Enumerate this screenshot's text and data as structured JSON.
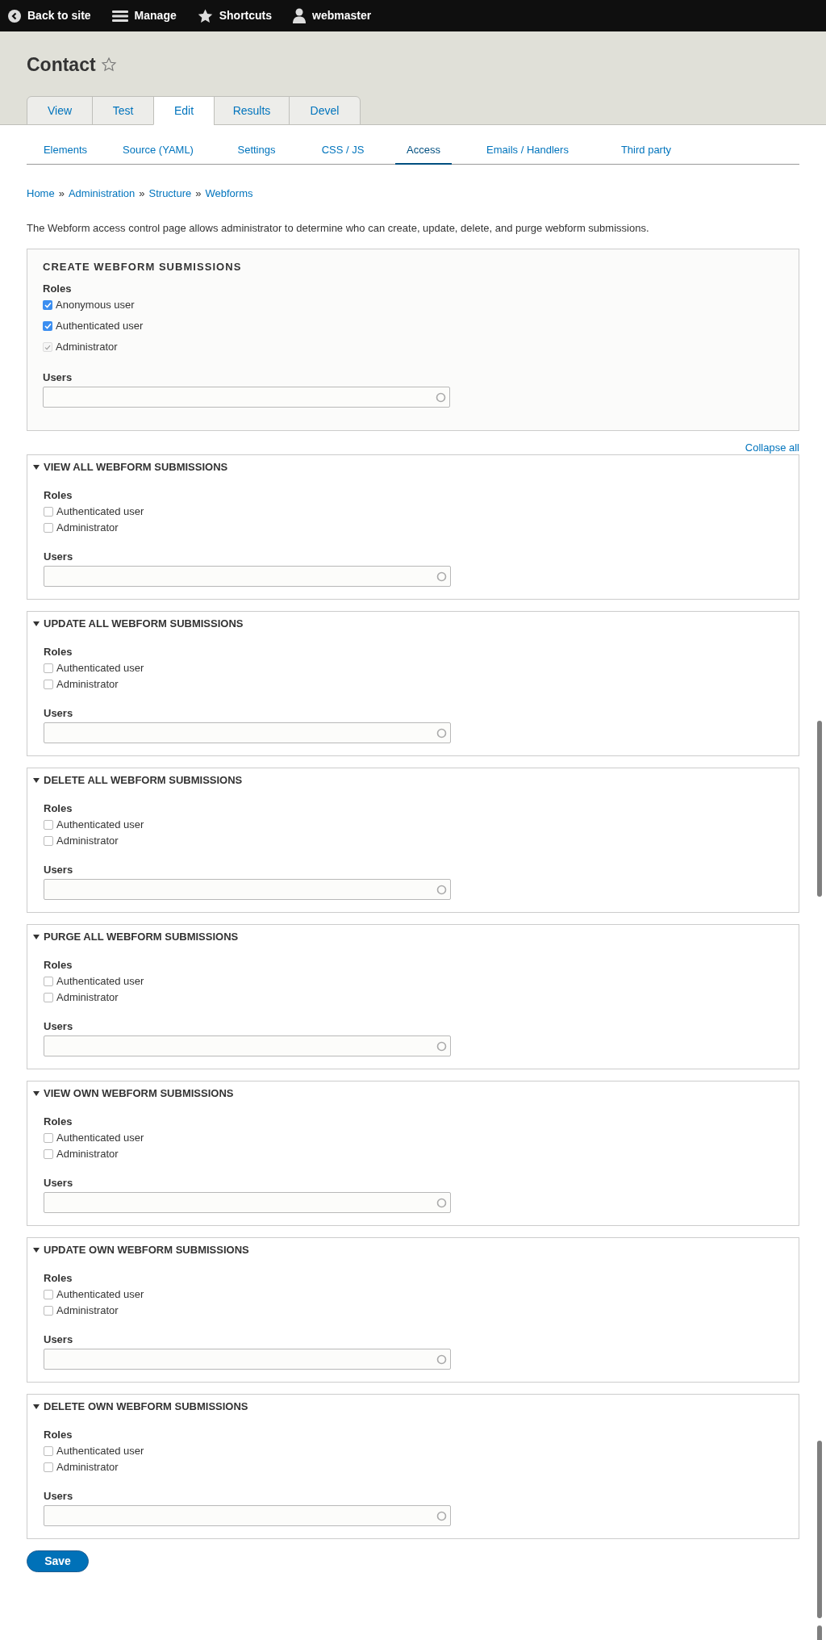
{
  "toolbar": [
    {
      "label": "Back to site"
    },
    {
      "label": "Manage"
    },
    {
      "label": "Shortcuts"
    },
    {
      "label": "webmaster"
    }
  ],
  "page_title": "Contact",
  "primary_tabs": [
    {
      "label": "View",
      "selected": false
    },
    {
      "label": "Test",
      "selected": false
    },
    {
      "label": "Edit",
      "selected": true
    },
    {
      "label": "Results",
      "selected": false
    },
    {
      "label": "Devel",
      "selected": false
    }
  ],
  "secondary_tabs": [
    {
      "label": "Elements",
      "selected": false
    },
    {
      "label": "Source (YAML)",
      "selected": false
    },
    {
      "label": "Settings",
      "selected": false
    },
    {
      "label": "CSS / JS",
      "selected": false
    },
    {
      "label": "Access",
      "selected": true
    },
    {
      "label": "Emails / Handlers",
      "selected": false
    },
    {
      "label": "Third party",
      "selected": false
    }
  ],
  "breadcrumb": [
    {
      "label": "Home"
    },
    {
      "separator": "»",
      "label": "Administration"
    },
    {
      "separator": "»",
      "label": "Structure"
    },
    {
      "separator": "»",
      "label": "Webforms"
    }
  ],
  "description": "The Webform access control page allows administrator to determine who can create, update, delete, and purge webform submissions.",
  "create_section": {
    "title": "CREATE WEBFORM SUBMISSIONS",
    "roles_label": "Roles",
    "roles": [
      {
        "label": "Anonymous user",
        "checked": true,
        "disabled": false
      },
      {
        "label": "Authenticated user",
        "checked": true,
        "disabled": false
      },
      {
        "label": "Administrator",
        "checked": true,
        "disabled": true
      }
    ],
    "users_label": "Users"
  },
  "collapse_all": "Collapse all",
  "sections": [
    {
      "title": "VIEW ALL WEBFORM SUBMISSIONS",
      "expanded": true,
      "roles_label": "Roles",
      "roles": [
        {
          "label": "Authenticated user",
          "checked": false,
          "disabled": false
        },
        {
          "label": "Administrator",
          "checked": false,
          "disabled": false
        }
      ],
      "users_label": "Users"
    },
    {
      "title": "UPDATE ALL WEBFORM SUBMISSIONS",
      "expanded": true,
      "roles_label": "Roles",
      "roles": [
        {
          "label": "Authenticated user",
          "checked": false,
          "disabled": false
        },
        {
          "label": "Administrator",
          "checked": false,
          "disabled": false
        }
      ],
      "users_label": "Users"
    },
    {
      "title": "DELETE ALL WEBFORM SUBMISSIONS",
      "expanded": true,
      "roles_label": "Roles",
      "roles": [
        {
          "label": "Authenticated user",
          "checked": false,
          "disabled": false
        },
        {
          "label": "Administrator",
          "checked": false,
          "disabled": false
        }
      ],
      "users_label": "Users"
    },
    {
      "title": "PURGE ALL WEBFORM SUBMISSIONS",
      "expanded": true,
      "roles_label": "Roles",
      "roles": [
        {
          "label": "Authenticated user",
          "checked": false,
          "disabled": false
        },
        {
          "label": "Administrator",
          "checked": false,
          "disabled": false
        }
      ],
      "users_label": "Users"
    },
    {
      "title": "VIEW OWN WEBFORM SUBMISSIONS",
      "expanded": true,
      "roles_label": "Roles",
      "roles": [
        {
          "label": "Authenticated user",
          "checked": false,
          "disabled": false
        },
        {
          "label": "Administrator",
          "checked": false,
          "disabled": false
        }
      ],
      "users_label": "Users"
    },
    {
      "title": "UPDATE OWN WEBFORM SUBMISSIONS",
      "expanded": true,
      "roles_label": "Roles",
      "roles": [
        {
          "label": "Authenticated user",
          "checked": false,
          "disabled": false
        },
        {
          "label": "Administrator",
          "checked": false,
          "disabled": false
        }
      ],
      "users_label": "Users"
    },
    {
      "title": "DELETE OWN WEBFORM SUBMISSIONS",
      "expanded": true,
      "roles_label": "Roles",
      "roles": [
        {
          "label": "Authenticated user",
          "checked": false,
          "disabled": false
        },
        {
          "label": "Administrator",
          "checked": false,
          "disabled": false
        }
      ],
      "users_label": "Users"
    }
  ],
  "save_button": "Save"
}
